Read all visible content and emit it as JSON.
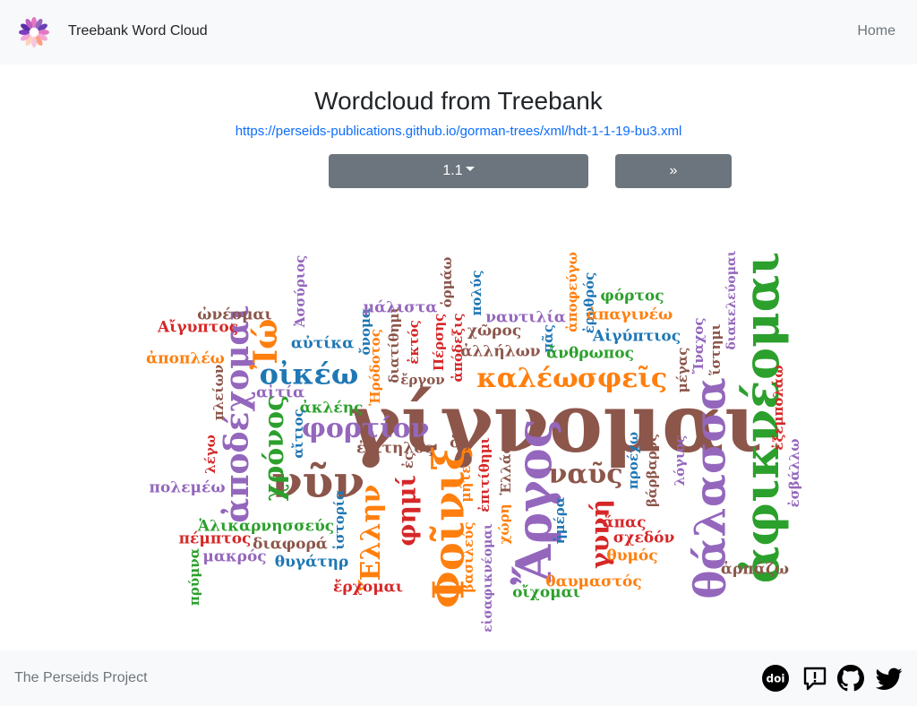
{
  "navbar": {
    "brand": "Treebank Word Cloud",
    "home_label": "Home"
  },
  "main": {
    "title": "Wordcloud from Treebank",
    "source_url": "https://perseids-publications.github.io/gorman-trees/xml/hdt-1-1-19-bu3.xml",
    "section_select_value": "1.1",
    "next_label": "»"
  },
  "footer": {
    "text": "The Perseids Project",
    "icons": [
      "doi-icon",
      "report-issue-icon",
      "github-icon",
      "twitter-icon"
    ]
  },
  "colors": {
    "blue": "#1f77b4",
    "orange": "#ff7f0e",
    "green": "#2ca02c",
    "red": "#d62728",
    "purple": "#9467bd",
    "brown": "#8c564b",
    "pink": "#e377c2",
    "grey": "#7f7f7f"
  },
  "words": [
    {
      "text": "γίγνομαι",
      "color": "brown"
    },
    {
      "text": "ἀφικνέομαι",
      "color": "green"
    },
    {
      "text": "θάλασσα",
      "color": "purple"
    },
    {
      "text": "Ἄργος",
      "color": "purple"
    },
    {
      "text": "Φοῖνιξ",
      "color": "orange"
    },
    {
      "text": "νῦν",
      "color": "brown"
    },
    {
      "text": "ἀποδέχομαι",
      "color": "purple"
    },
    {
      "text": "χρόνος",
      "color": "green"
    },
    {
      "text": "οἰκέω",
      "color": "blue"
    },
    {
      "text": "Ἰώ",
      "color": "orange"
    },
    {
      "text": "φορτίον",
      "color": "purple"
    },
    {
      "text": "καλέω",
      "color": "orange"
    },
    {
      "text": "σφεῖς",
      "color": "orange"
    },
    {
      "text": "ναῦς",
      "color": "brown"
    },
    {
      "text": "γυνή",
      "color": "red"
    },
    {
      "text": "Ἕλλην",
      "color": "orange"
    },
    {
      "text": "φημί",
      "color": "red"
    },
    {
      "text": "ὠνέομαι",
      "color": "brown"
    },
    {
      "text": "Αἴγυπτος",
      "color": "red"
    },
    {
      "text": "ἀποπλέω",
      "color": "orange"
    },
    {
      "text": "αὐτίκα",
      "color": "blue"
    },
    {
      "text": "αἰτία",
      "color": "purple"
    },
    {
      "text": "ἀκλέης",
      "color": "green"
    },
    {
      "text": "αἴτιος",
      "color": "blue"
    },
    {
      "text": "πλείων",
      "color": "brown"
    },
    {
      "text": "λέγω",
      "color": "red"
    },
    {
      "text": "πολεμέω",
      "color": "purple"
    },
    {
      "text": "Ἀσσύριος",
      "color": "purple"
    },
    {
      "text": "ὄνομα",
      "color": "blue"
    },
    {
      "text": "Ἡρόδοτος",
      "color": "orange"
    },
    {
      "text": "διατίθημι",
      "color": "brown"
    },
    {
      "text": "ἐκτός",
      "color": "red"
    },
    {
      "text": "ἔργον",
      "color": "brown"
    },
    {
      "text": "μάλιστα",
      "color": "purple"
    },
    {
      "text": "Πέρσης",
      "color": "red"
    },
    {
      "text": "ὁρμάω",
      "color": "brown"
    },
    {
      "text": "ἀπόδεξις",
      "color": "red"
    },
    {
      "text": "χῶρος",
      "color": "brown"
    },
    {
      "text": "ἀλλήλων",
      "color": "brown"
    },
    {
      "text": "πολύς",
      "color": "blue"
    },
    {
      "text": "ναυτιλία",
      "color": "purple"
    },
    {
      "text": "πᾶς",
      "color": "blue"
    },
    {
      "text": "ἀποφεύγω",
      "color": "orange"
    },
    {
      "text": "ἐρυθρός",
      "color": "blue"
    },
    {
      "text": "φόρτος",
      "color": "green"
    },
    {
      "text": "ἀπαγινέω",
      "color": "orange"
    },
    {
      "text": "Αἰγύπτιος",
      "color": "blue"
    },
    {
      "text": "ἄνθρωπος",
      "color": "green"
    },
    {
      "text": "Ἴναχος",
      "color": "purple"
    },
    {
      "text": "ἵστημι",
      "color": "brown"
    },
    {
      "text": "μέγας",
      "color": "brown"
    },
    {
      "text": "διακελεύομαι",
      "color": "purple"
    },
    {
      "text": "ἐξεμπολάω",
      "color": "red"
    },
    {
      "text": "ἐσβάλλω",
      "color": "purple"
    },
    {
      "text": "ἐξίτηλος",
      "color": "brown"
    },
    {
      "text": "ὅς",
      "color": "brown"
    },
    {
      "text": "ἐπιτίθημι",
      "color": "red"
    },
    {
      "text": "Ἑλλάς",
      "color": "brown"
    },
    {
      "text": "προέχω",
      "color": "blue"
    },
    {
      "text": "βάρβαρος",
      "color": "brown"
    },
    {
      "text": "λόγιος",
      "color": "purple"
    },
    {
      "text": "ἐς",
      "color": "brown"
    },
    {
      "text": "ἱστορία",
      "color": "blue"
    },
    {
      "text": "Ἁλικαρνησσεύς",
      "color": "green"
    },
    {
      "text": "πέμπτος",
      "color": "red"
    },
    {
      "text": "διαφορά",
      "color": "brown"
    },
    {
      "text": "μακρός",
      "color": "purple"
    },
    {
      "text": "θυγάτηρ",
      "color": "blue"
    },
    {
      "text": "πρύμνα",
      "color": "green"
    },
    {
      "text": "ἔρχομαι",
      "color": "red"
    },
    {
      "text": "μήτε",
      "color": "orange"
    },
    {
      "text": "βασιλεύς",
      "color": "orange"
    },
    {
      "text": "χώρη",
      "color": "orange"
    },
    {
      "text": "εἰσαφικνέομαι",
      "color": "purple"
    },
    {
      "text": "ἡμέρα",
      "color": "blue"
    },
    {
      "text": "οἴχομαι",
      "color": "green"
    },
    {
      "text": "ἅπας",
      "color": "red"
    },
    {
      "text": "σχεδόν",
      "color": "red"
    },
    {
      "text": "θυμός",
      "color": "orange"
    },
    {
      "text": "θαυμαστός",
      "color": "orange"
    },
    {
      "text": "ἁρπάζω",
      "color": "brown"
    }
  ]
}
